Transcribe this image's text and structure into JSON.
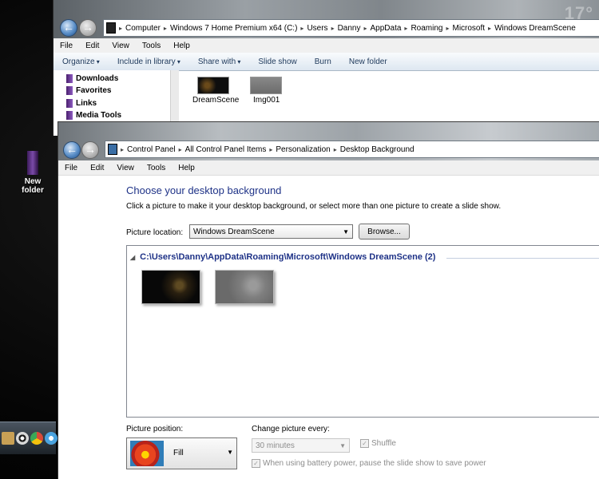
{
  "desktop": {
    "icon_label_line1": "New",
    "icon_label_line2": "folder"
  },
  "explorer": {
    "breadcrumb": [
      "Computer",
      "Windows 7 Home Premium x64 (C:)",
      "Users",
      "Danny",
      "AppData",
      "Roaming",
      "Microsoft",
      "Windows DreamScene"
    ],
    "menu": [
      "File",
      "Edit",
      "View",
      "Tools",
      "Help"
    ],
    "toolbar": {
      "organize": "Organize",
      "include": "Include in library",
      "share": "Share with",
      "slideshow": "Slide show",
      "burn": "Burn",
      "new_folder": "New folder"
    },
    "nav_items": [
      "Downloads",
      "Favorites",
      "Links",
      "Media Tools"
    ],
    "files": [
      "DreamScene",
      "Img001"
    ]
  },
  "control_panel": {
    "breadcrumb": [
      "Control Panel",
      "All Control Panel Items",
      "Personalization",
      "Desktop Background"
    ],
    "menu": [
      "File",
      "Edit",
      "View",
      "Tools",
      "Help"
    ],
    "title": "Choose your desktop background",
    "subtitle": "Click a picture to make it your desktop background, or select more than one picture to create a slide show.",
    "picture_location_label": "Picture location:",
    "picture_location_value": "Windows DreamScene",
    "browse_label": "Browse...",
    "folder_header": "C:\\Users\\Danny\\AppData\\Roaming\\Microsoft\\Windows DreamScene (2)",
    "picture_position_label": "Picture position:",
    "picture_position_value": "Fill",
    "change_every_label": "Change picture every:",
    "change_every_value": "30 minutes",
    "shuffle_label": "Shuffle",
    "battery_label": "When using battery power, pause the slide show to save power"
  }
}
